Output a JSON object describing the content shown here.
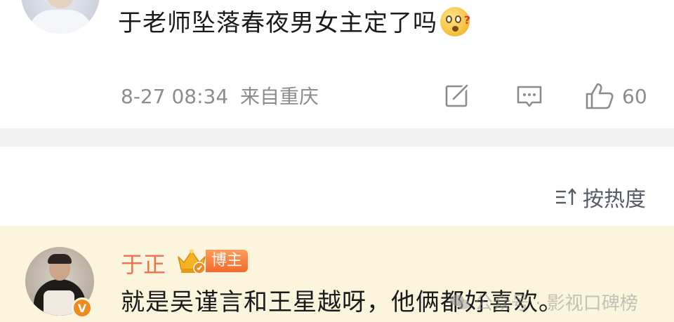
{
  "post": {
    "text": "于老师坠落春夜男女主定了吗",
    "emoji": "shocked-face-emoji",
    "timestamp": "8-27 08:34",
    "source": "来自重庆",
    "like_count": "60"
  },
  "sort": {
    "label": "按热度"
  },
  "comment": {
    "author": "于正",
    "badge": "博主",
    "text": "就是吴谨言和王星越呀，他俩都好喜欢。",
    "verified": "V"
  },
  "watermark": {
    "text": "公众号 · 影视口碑榜"
  },
  "colors": {
    "author_name": "#eb7350",
    "highlight_bg": "#fbf5dd",
    "muted": "#8c8c8c",
    "divider": "#f2f2f2"
  }
}
